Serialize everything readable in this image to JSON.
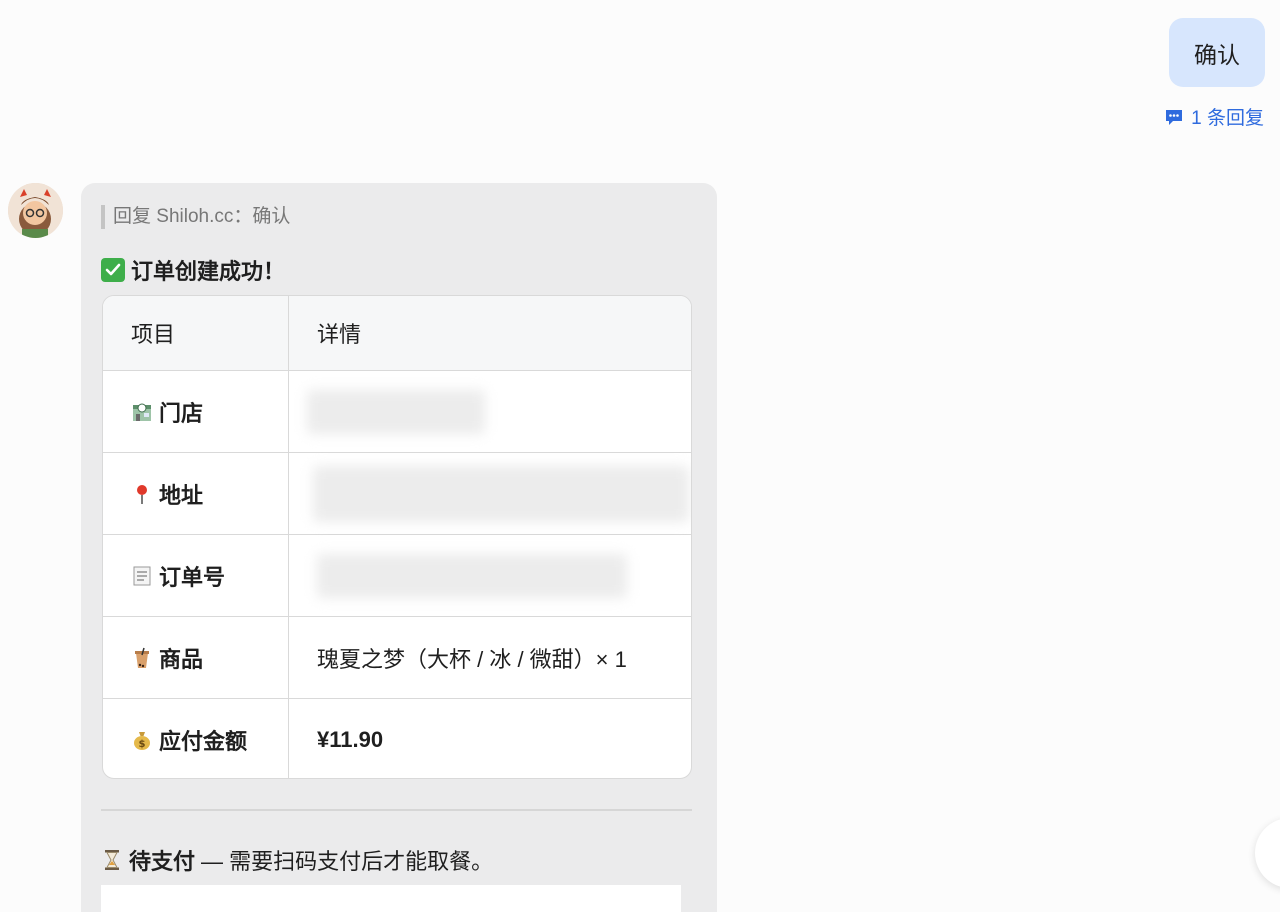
{
  "outgoing": {
    "text": "确认",
    "reply_count": "1 条回复"
  },
  "incoming": {
    "quote": "回复 Shiloh.cc：确认",
    "title": "订单创建成功！",
    "table": {
      "headers": [
        "项目",
        "详情"
      ],
      "rows": [
        {
          "icon": "store-24-icon",
          "label": "门店",
          "value": ""
        },
        {
          "icon": "pin-icon",
          "label": "地址",
          "value": ""
        },
        {
          "icon": "receipt-icon",
          "label": "订单号",
          "value": ""
        },
        {
          "icon": "bubble-tea-icon",
          "label": "商品",
          "value": "瑰夏之梦（大杯 / 冰 / 微甜）× 1"
        },
        {
          "icon": "money-bag-icon",
          "label": "应付金额",
          "value": "¥11.90"
        }
      ]
    },
    "pay_status_label": "待支付",
    "pay_status_text": "— 需要扫码支付后才能取餐。"
  },
  "colors": {
    "outgoing_bubble": "#d7e6fd",
    "link_blue": "#2f6bde",
    "card_bg": "#ebebec",
    "success_green": "#3eae4a"
  }
}
